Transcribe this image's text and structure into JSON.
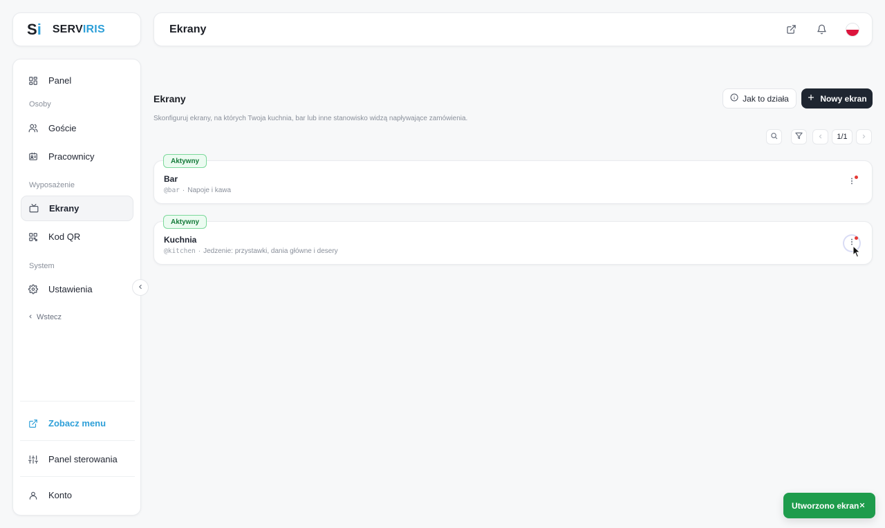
{
  "brand": {
    "mark_s": "S",
    "mark_i": "i",
    "name_dark": "SERV",
    "name_blue": "IRIS",
    "color_blue": "#2d9fd8"
  },
  "header": {
    "title": "Ekrany",
    "icons": [
      "external-link-icon",
      "bell-icon",
      "poland-flag-icon"
    ]
  },
  "sidebar": {
    "items": {
      "panel": "Panel",
      "guests": "Goście",
      "staff": "Pracownicy",
      "screens": "Ekrany",
      "qr": "Kod QR",
      "settings": "Ustawienia"
    },
    "sections": {
      "people": "Osoby",
      "equipment": "Wyposażenie",
      "system": "System"
    },
    "back": "Wstecz",
    "footer": {
      "view_menu": "Zobacz menu",
      "control_panel": "Panel sterowania",
      "account": "Konto"
    }
  },
  "main": {
    "title": "Ekrany",
    "description": "Skonfiguruj ekrany, na których Twoja kuchnia, bar lub inne stanowisko widzą napływające zamówienia.",
    "help_button": "Jak to działa",
    "new_button": "Nowy ekran",
    "pager": "1/1",
    "rows": [
      {
        "badge": "Aktywny",
        "name": "Bar",
        "code": "@bar",
        "desc": "Napoje i kawa"
      },
      {
        "badge": "Aktywny",
        "name": "Kuchnia",
        "code": "@kitchen",
        "desc": "Jedzenie: przystawki, dania główne i desery"
      }
    ],
    "meta_separator": "·"
  },
  "toast": {
    "message": "Utworzono ekran"
  },
  "colors": {
    "active_green": "#157a3a",
    "toast_green": "#1e9c4c",
    "primary_dark": "#1f2631",
    "notification_red": "#e53935"
  }
}
